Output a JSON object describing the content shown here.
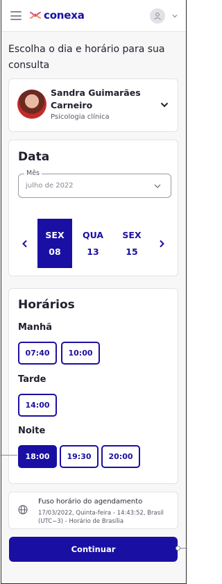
{
  "header": {
    "brand": "conexa",
    "menu_icon": "hamburger-icon",
    "account_icon": "user-icon"
  },
  "page": {
    "title": "Escolha o dia e horário para sua consulta"
  },
  "doctor": {
    "name": "Sandra Guimarães Carneiro",
    "specialty": "Psicologia clínica"
  },
  "date_section": {
    "title": "Data",
    "month_label": "Mês",
    "month_value": "julho de 2022",
    "dates": [
      {
        "weekday": "SEX",
        "day": "08",
        "selected": true
      },
      {
        "weekday": "QUA",
        "day": "13",
        "selected": false
      },
      {
        "weekday": "SEX",
        "day": "15",
        "selected": false
      }
    ]
  },
  "times_section": {
    "title": "Horários",
    "periods": [
      {
        "label": "Manhã",
        "times": [
          "07:40",
          "10:00"
        ]
      },
      {
        "label": "Tarde",
        "times": [
          "14:00"
        ]
      },
      {
        "label": "Noite",
        "times": [
          "18:00",
          "19:30",
          "20:00"
        ]
      }
    ],
    "selected_time": "18:00"
  },
  "timezone": {
    "title": "Fuso horário do agendamento",
    "detail": "17/03/2022, Quinta-feira - 14:43:52, Brasil (UTC−3) - Horário de Brasília"
  },
  "actions": {
    "continue_label": "Continuar"
  },
  "colors": {
    "primary": "#1a0fa3",
    "brand_accent": "#e0457b"
  }
}
